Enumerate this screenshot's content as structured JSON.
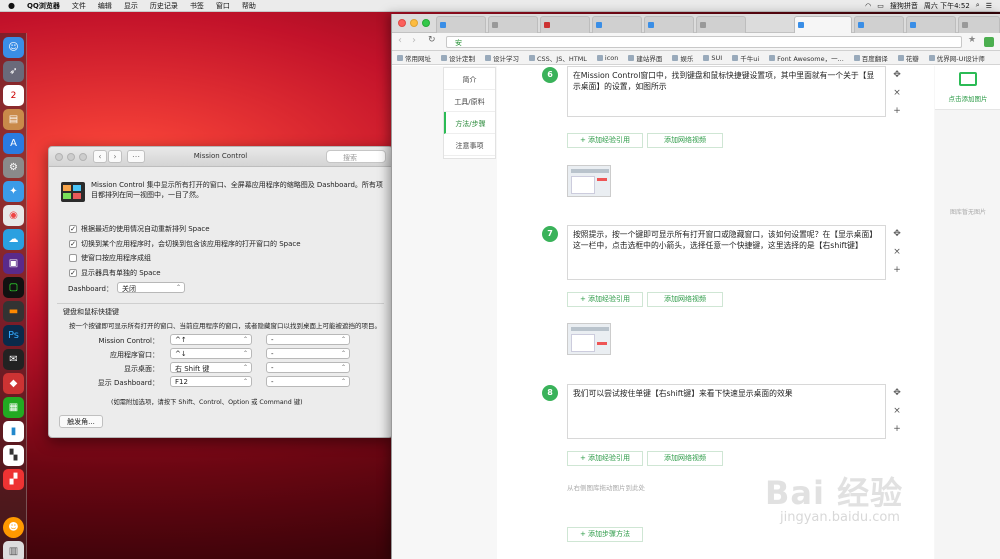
{
  "menubar": {
    "apple": "",
    "app": "QQ浏览器",
    "items": [
      "文件",
      "编辑",
      "显示",
      "历史记录",
      "书签",
      "窗口",
      "帮助"
    ],
    "ime": "搜狗拼音",
    "datetime": "周六 下午4:52"
  },
  "dock": {
    "calendar_day": "2"
  },
  "mission_control": {
    "title": "Mission Control",
    "search_placeholder": "搜索",
    "description": "Mission Control 集中显示所有打开的窗口、全屏幕应用程序的缩略图及 Dashboard。所有项目都排列在同一视图中，一目了然。",
    "checkboxes": [
      {
        "label": "根据最近的使用情况自动重新排列 Space",
        "checked": true
      },
      {
        "label": "切换到某个应用程序时，会切换到包含该应用程序的打开窗口的 Space",
        "checked": true
      },
      {
        "label": "使窗口按应用程序成组",
        "checked": false
      },
      {
        "label": "显示器具有单独的 Space",
        "checked": true
      }
    ],
    "dashboard_label": "Dashboard：",
    "dashboard_value": "关闭",
    "shortcuts_heading": "键盘和鼠标快捷键",
    "shortcuts_desc": "按一个按键即可显示所有打开的窗口、当前应用程序的窗口，或者隐藏窗口以找到桌面上可能被遮挡的项目。",
    "shortcuts": [
      {
        "label": "Mission Control：",
        "key": "^↑",
        "mouse": "-"
      },
      {
        "label": "应用程序窗口：",
        "key": "^↓",
        "mouse": "-"
      },
      {
        "label": "显示桌面：",
        "key": "右 Shift 键",
        "mouse": "-"
      },
      {
        "label": "显示 Dashboard：",
        "key": "F12",
        "mouse": "-"
      }
    ],
    "modifier_note": "(如需附加选项，请按下 Shift、Control、Option 或 Command 键)",
    "hot_corners": "触发角..."
  },
  "browser": {
    "address": "安",
    "bookmarks": [
      "常用网址",
      "设计定制",
      "设计学习",
      "CSS、JS、HTML",
      "icon",
      "建站界面",
      "娱乐",
      "SUI",
      "千牛ui",
      "Font Awesome，一...",
      "百度翻译",
      "花瓣",
      "优界网-UI设计师"
    ],
    "left_nav": [
      "简介",
      "工具/原料",
      "方法/步骤",
      "注意事项"
    ],
    "active_nav": 2,
    "steps": [
      {
        "num": "6",
        "text": "在Mission Control窗口中，找到键盘和鼠标快捷键设置项，其中里面就有一个关于【显示桌面】的设置，如图所示"
      },
      {
        "num": "7",
        "text": "按照提示，按一个键即可显示所有打开窗口或隐藏窗口，该如何设置呢？在【显示桌面】这一栏中，点击选框中的小箭头，选择任意一个快捷键，这里选择的是【右shift键】"
      },
      {
        "num": "8",
        "text": "我们可以尝试按住单键【右shift键】来看下快速显示桌面的效果"
      }
    ],
    "add_ref": "+ 添加经验引用",
    "add_video": "添加网络视频",
    "drag_hint": "从右侧图库拖动图片到此处",
    "add_method": "+ 添加步骤方法",
    "upload_label": "点击添加图片",
    "gallery_empty": "图库暂无图片"
  },
  "watermark": {
    "brand": "Bai 经验",
    "url": "jingyan.baidu.com"
  }
}
